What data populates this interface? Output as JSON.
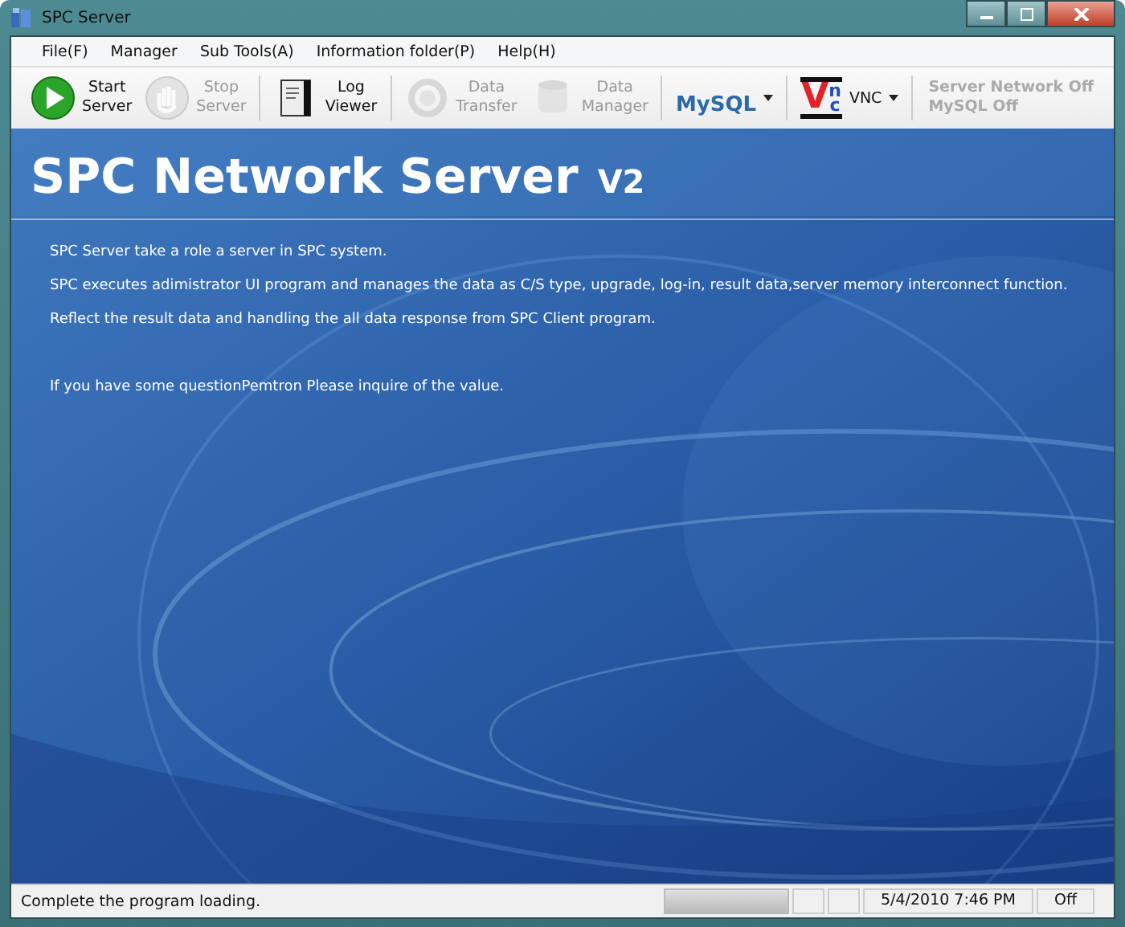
{
  "window": {
    "title": "SPC Server"
  },
  "menu": [
    {
      "label": "File(F)"
    },
    {
      "label": "Manager"
    },
    {
      "label": "Sub Tools(A)"
    },
    {
      "label": "Information folder(P)"
    },
    {
      "label": "Help(H)"
    }
  ],
  "toolbar": [
    [
      {
        "kind": "start",
        "lines": [
          "Start",
          "Server"
        ],
        "disabled": false
      },
      {
        "kind": "stop",
        "lines": [
          "Stop",
          "Server"
        ],
        "disabled": true
      }
    ],
    [
      {
        "kind": "log",
        "lines": [
          "Log",
          "Viewer"
        ],
        "disabled": false
      }
    ],
    [
      {
        "kind": "transfer",
        "lines": [
          "Data",
          "Transfer"
        ],
        "disabled": true
      },
      {
        "kind": "database",
        "lines": [
          "Data",
          "Manager"
        ],
        "disabled": true
      }
    ],
    [
      {
        "kind": "mysql",
        "logo_text": "MySQL"
      }
    ],
    [
      {
        "kind": "vnc",
        "logo_text": [
          "V",
          "n",
          "c"
        ],
        "label": "VNC"
      }
    ],
    [
      {
        "kind": "status",
        "lines": [
          "Server Network Off",
          "MySQL Off"
        ]
      }
    ]
  ],
  "content": {
    "title": "SPC Network Server",
    "version": "V2",
    "paragraphs": [
      "SPC Server take a role a server in SPC system.",
      "SPC executes adimistrator UI program and manages the data as C/S type, upgrade, log-in, result data,server memory interconnect function.",
      "Reflect the result data and handling the all data response from SPC Client program."
    ],
    "note": "If you have some questionPemtron Please inquire of the value."
  },
  "status_bar": {
    "message": "Complete the program loading.",
    "progress": {
      "level": 1
    },
    "datetime": "5/4/2010 7:46 PM",
    "state": "Off"
  }
}
